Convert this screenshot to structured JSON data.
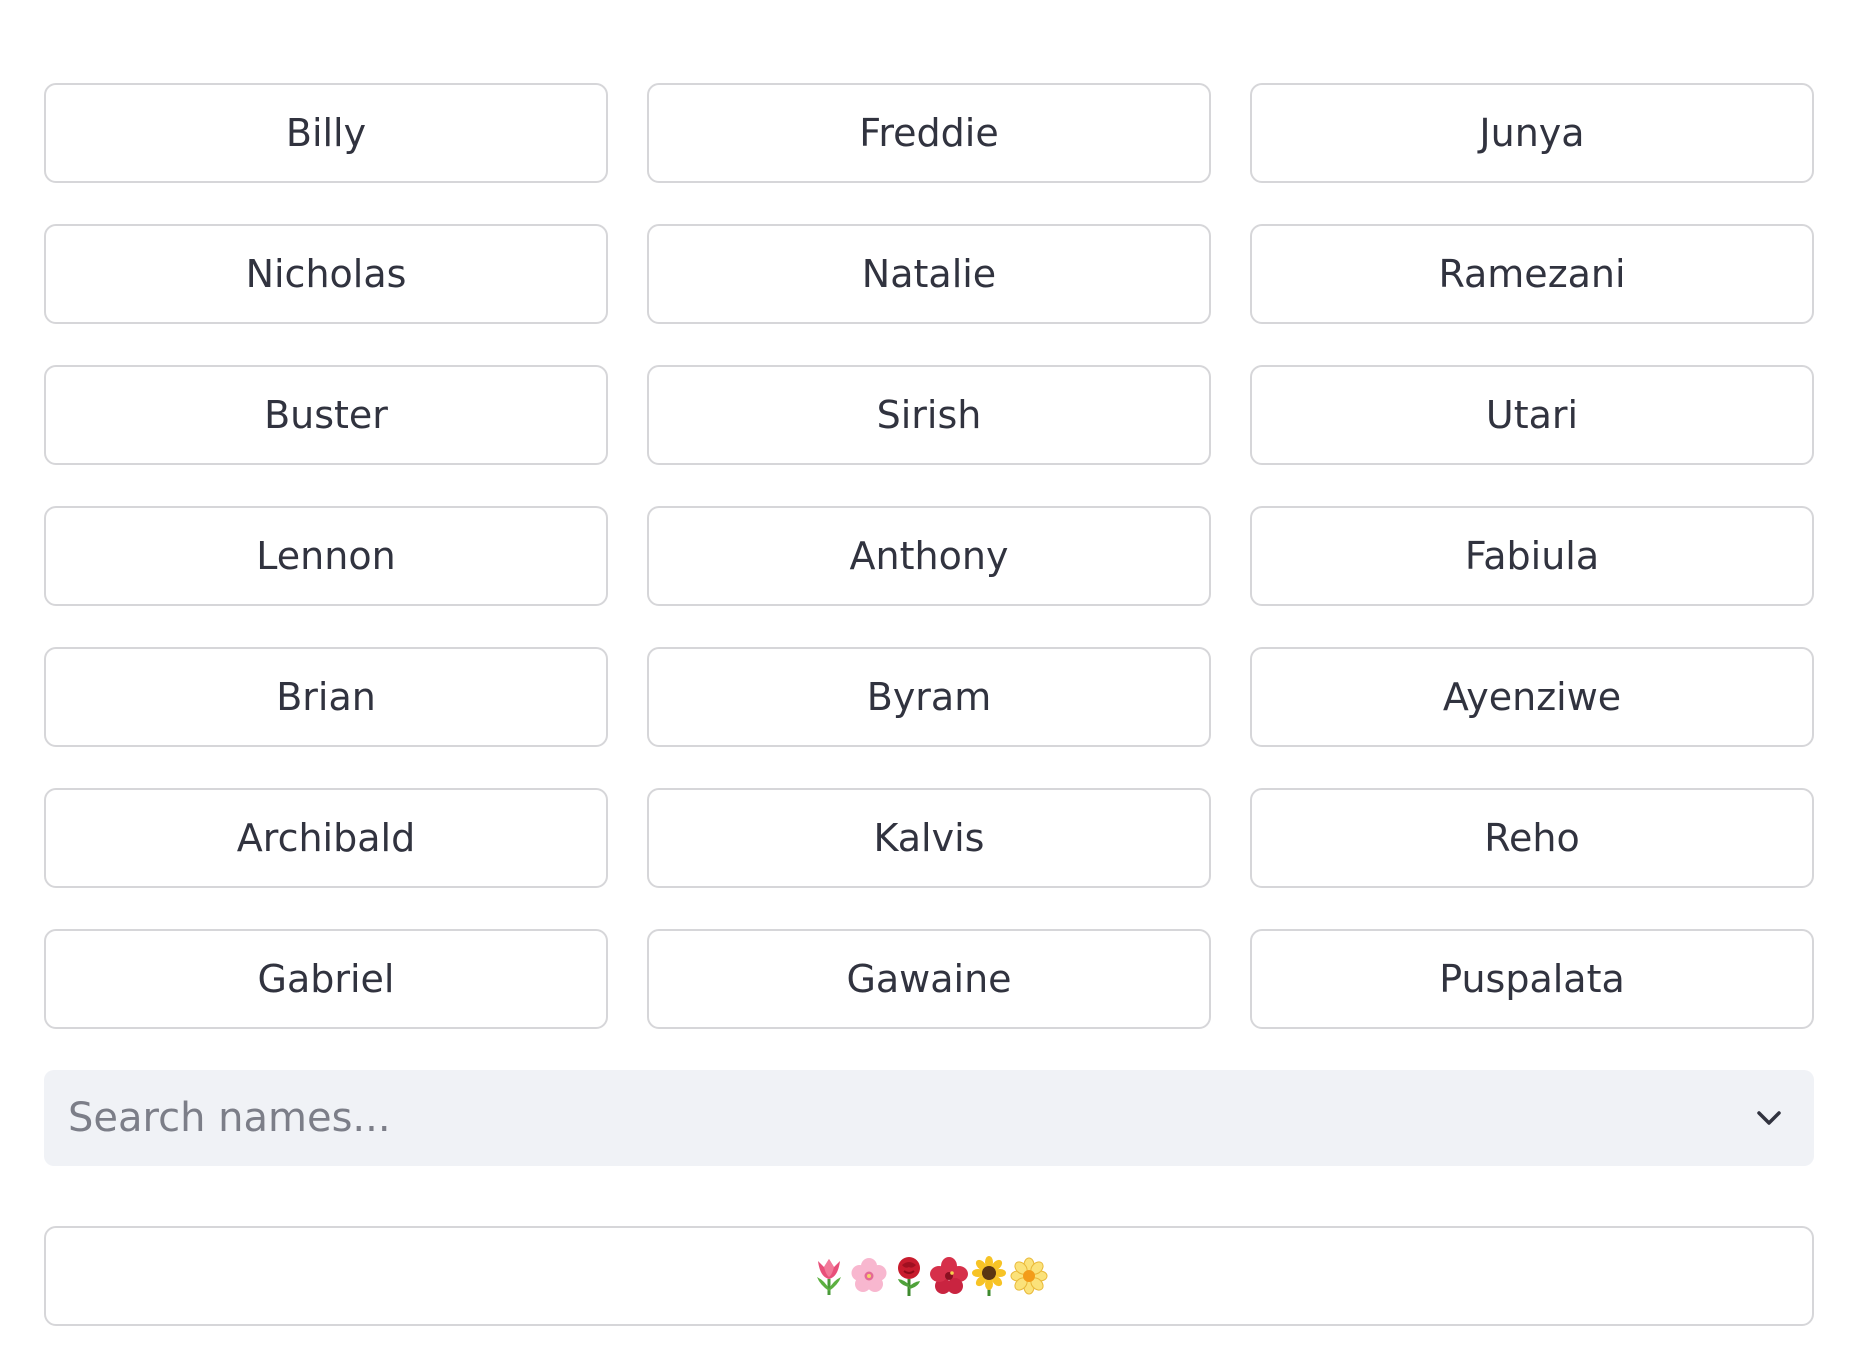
{
  "names": [
    "Billy",
    "Freddie",
    "Junya",
    "Nicholas",
    "Natalie",
    "Ramezani",
    "Buster",
    "Sirish",
    "Utari",
    "Lennon",
    "Anthony",
    "Fabiula",
    "Brian",
    "Byram",
    "Ayenziwe",
    "Archibald",
    "Kalvis",
    "Reho",
    "Gabriel",
    "Gawaine",
    "Puspalata"
  ],
  "search": {
    "placeholder": "Search names...",
    "icon": "chevron-down-icon"
  },
  "flower_button": {
    "icons": [
      "tulip-icon",
      "cherry-blossom-icon",
      "rose-icon",
      "hibiscus-icon",
      "sunflower-icon",
      "blossom-icon"
    ]
  },
  "colors": {
    "border": "#d6d6d9",
    "text": "#31333f",
    "search_bg": "#f0f2f6",
    "placeholder": "#7c7e88"
  }
}
